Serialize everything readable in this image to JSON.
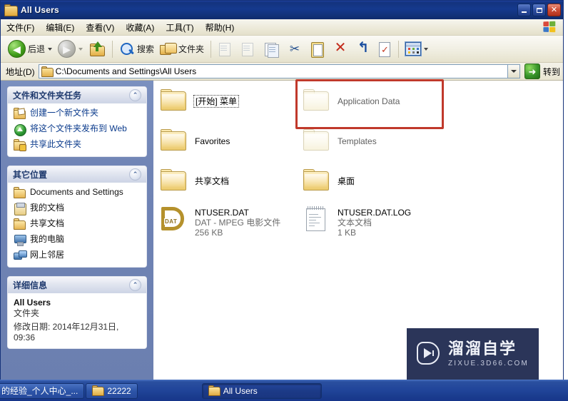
{
  "window": {
    "title": "All Users",
    "title_icon": "folder-icon",
    "buttons": {
      "minimize": "minimize-icon",
      "maximize": "maximize-icon",
      "close": "close-icon"
    }
  },
  "menubar": {
    "items": [
      {
        "label": "文件(F)"
      },
      {
        "label": "编辑(E)"
      },
      {
        "label": "查看(V)"
      },
      {
        "label": "收藏(A)"
      },
      {
        "label": "工具(T)"
      },
      {
        "label": "帮助(H)"
      }
    ],
    "logo": "windows-flag-logo"
  },
  "toolbar": {
    "back_label": "后退",
    "forward_label": "",
    "up_label": "",
    "search_label": "搜索",
    "folders_label": "文件夹",
    "icons": [
      "back-icon",
      "back-dropdown-icon",
      "forward-icon",
      "forward-dropdown-icon",
      "up-one-level-icon",
      "search-icon",
      "folders-icon",
      "move-to-folder-icon",
      "copy-to-folder-icon",
      "copy-icon",
      "cut-icon",
      "paste-icon",
      "delete-icon",
      "undo-icon",
      "properties-icon",
      "views-icon",
      "views-dropdown-icon"
    ]
  },
  "address_bar": {
    "label": "地址(D)",
    "value": "C:\\Documents and Settings\\All Users",
    "folder_icon": "folder-icon",
    "dropdown_icon": "chevron-down-icon",
    "go_label": "转到",
    "go_icon": "go-arrow-icon"
  },
  "sidebar": {
    "panels": [
      {
        "title": "文件和文件夹任务",
        "collapse_icon": "chevron-up-icon",
        "items": [
          {
            "icon": "new-folder-icon",
            "label": "创建一个新文件夹"
          },
          {
            "icon": "publish-to-web-icon",
            "label": "将这个文件夹发布到 Web"
          },
          {
            "icon": "share-folder-icon",
            "label": "共享此文件夹"
          }
        ]
      },
      {
        "title": "其它位置",
        "collapse_icon": "chevron-up-icon",
        "items": [
          {
            "icon": "folder-icon",
            "label": "Documents and Settings"
          },
          {
            "icon": "my-documents-icon",
            "label": "我的文档"
          },
          {
            "icon": "folder-icon",
            "label": "共享文档"
          },
          {
            "icon": "my-computer-icon",
            "label": "我的电脑"
          },
          {
            "icon": "network-places-icon",
            "label": "网上邻居"
          }
        ]
      },
      {
        "title": "详细信息",
        "collapse_icon": "chevron-up-icon",
        "details": {
          "name": "All Users",
          "type": "文件夹",
          "modified": "修改日期: 2014年12月31日, 09:36"
        }
      }
    ]
  },
  "file_list": {
    "items": [
      {
        "name": "[开始] 菜单",
        "icon": "folder-icon",
        "sub1": "",
        "sub2": "",
        "faded": false,
        "focused": true
      },
      {
        "name": "Application Data",
        "icon": "folder-icon",
        "sub1": "",
        "sub2": "",
        "faded": true,
        "focused": false
      },
      {
        "name": "Favorites",
        "icon": "folder-icon",
        "sub1": "",
        "sub2": "",
        "faded": false,
        "focused": false
      },
      {
        "name": "Templates",
        "icon": "folder-icon",
        "sub1": "",
        "sub2": "",
        "faded": true,
        "focused": false
      },
      {
        "name": "共享文档",
        "icon": "folder-icon",
        "sub1": "",
        "sub2": "",
        "faded": false,
        "focused": false
      },
      {
        "name": "桌面",
        "icon": "folder-icon",
        "sub1": "",
        "sub2": "",
        "faded": false,
        "focused": false
      },
      {
        "name": "NTUSER.DAT",
        "icon": "dat-file-icon",
        "sub1": "DAT - MPEG 电影文件",
        "sub2": "256 KB",
        "faded": false,
        "focused": false
      },
      {
        "name": "NTUSER.DAT.LOG",
        "icon": "text-file-icon",
        "sub1": "文本文档",
        "sub2": "1 KB",
        "faded": false,
        "focused": false
      }
    ]
  },
  "annotation": {
    "color": "#c0392b",
    "target": "Application Data"
  },
  "watermark": {
    "cn": "溜溜自学",
    "en": "ZIXUE.3D66.COM",
    "bg": "#2b3559",
    "logo": "play-button-logo"
  },
  "taskbar": {
    "buttons": [
      {
        "label": "的经验_个人中心_...",
        "icon": "",
        "active": false,
        "clipped": true
      },
      {
        "label": "22222",
        "icon": "folder-icon",
        "active": false,
        "clipped": false
      },
      {
        "label": "All Users",
        "icon": "folder-icon",
        "active": true,
        "clipped": false
      }
    ]
  }
}
